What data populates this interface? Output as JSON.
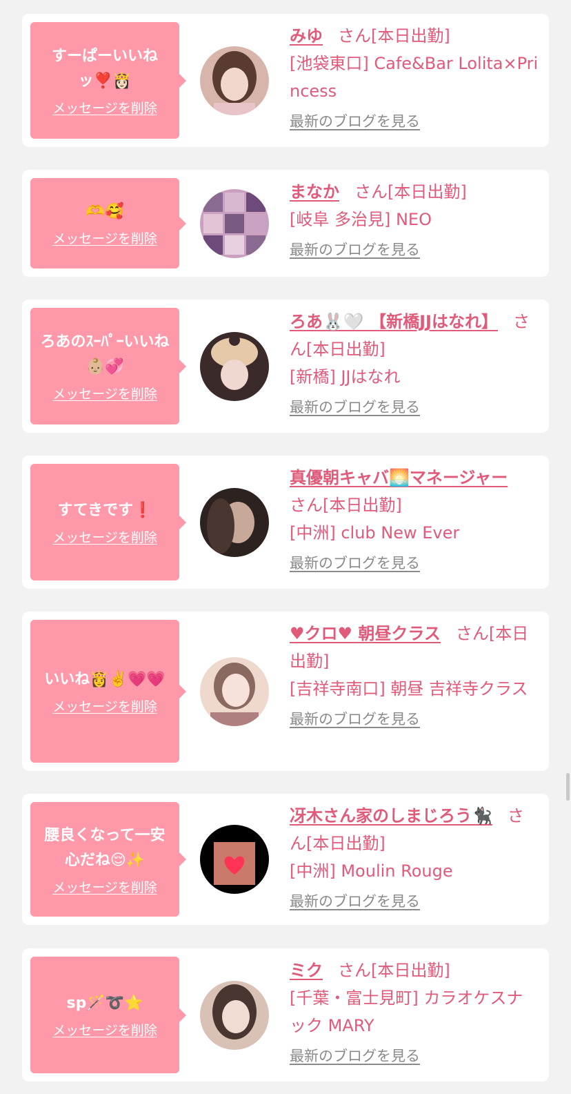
{
  "items": [
    {
      "message": "すーぱーいいねッ❣️👸🏻",
      "delete_label": "メッセージを削除",
      "name": "みゆ",
      "suffix": "さん[本日出勤]",
      "shop": "[池袋東口] Cafe&Bar Lolita×Princess",
      "blog_label": "最新のブログを見る",
      "avatar_icon": "avatar-photo",
      "avatar_colors": [
        "#d8b5aa",
        "#5a3b32"
      ]
    },
    {
      "message": "🫶🥰",
      "delete_label": "メッセージを削除",
      "name": "まなか",
      "suffix": "さん[本日出勤]",
      "shop": "[岐阜 多治見] NEO",
      "blog_label": "最新のブログを見る",
      "avatar_icon": "avatar-photo",
      "avatar_colors": [
        "#c9a0c0",
        "#6d4a7a"
      ]
    },
    {
      "message": "ろあのｽｰﾊﾟｰいいね👶🏼💞",
      "delete_label": "メッセージを削除",
      "name": "ろあ🐰🤍 【新橋JJはなれ】",
      "suffix": "さん[本日出勤]",
      "shop": "[新橋] JJはなれ",
      "blog_label": "最新のブログを見る",
      "avatar_icon": "avatar-photo",
      "avatar_colors": [
        "#e6c9a8",
        "#3a2a2a"
      ]
    },
    {
      "message": "すてきです❗️",
      "delete_label": "メッセージを削除",
      "name": "真優朝キャバ🌅マネージャー",
      "suffix": "さん[本日出勤]",
      "shop": "[中洲] club New Ever",
      "blog_label": "最新のブログを見る",
      "avatar_icon": "avatar-photo",
      "avatar_colors": [
        "#a88a7a",
        "#2c2220"
      ]
    },
    {
      "message": "いいね👸✌️💗💗",
      "delete_label": "メッセージを削除",
      "name": "♥クロ♥ 朝昼クラス",
      "suffix": "さん[本日出勤]",
      "shop": "[吉祥寺南口] 朝昼 吉祥寺クラス",
      "blog_label": "最新のブログを見る",
      "avatar_icon": "avatar-photo",
      "avatar_colors": [
        "#efd9cf",
        "#b08080"
      ]
    },
    {
      "message": "腰良くなって一安心だね😌✨",
      "delete_label": "メッセージを削除",
      "name": "冴木さん家のしまじろう🐈‍⬛",
      "suffix": "さん[本日出勤]",
      "shop": "[中洲] Moulin Rouge",
      "blog_label": "最新のブログを見る",
      "avatar_icon": "avatar-photo",
      "avatar_colors": [
        "#000000",
        "#c97a6a"
      ]
    },
    {
      "message": "sp🪄➰⭐️",
      "delete_label": "メッセージを削除",
      "name": "ミク",
      "suffix": "さん[本日出勤]",
      "shop": "[千葉・富士見町] カラオケスナック MARY",
      "blog_label": "最新のブログを見る",
      "avatar_icon": "avatar-photo",
      "avatar_colors": [
        "#d9c2b5",
        "#4a3630"
      ]
    }
  ],
  "colors": {
    "accent": "#e05a7a",
    "bubble": "#ff99aa",
    "background": "#f2f2f2",
    "link_gray": "#8a8a8a"
  }
}
